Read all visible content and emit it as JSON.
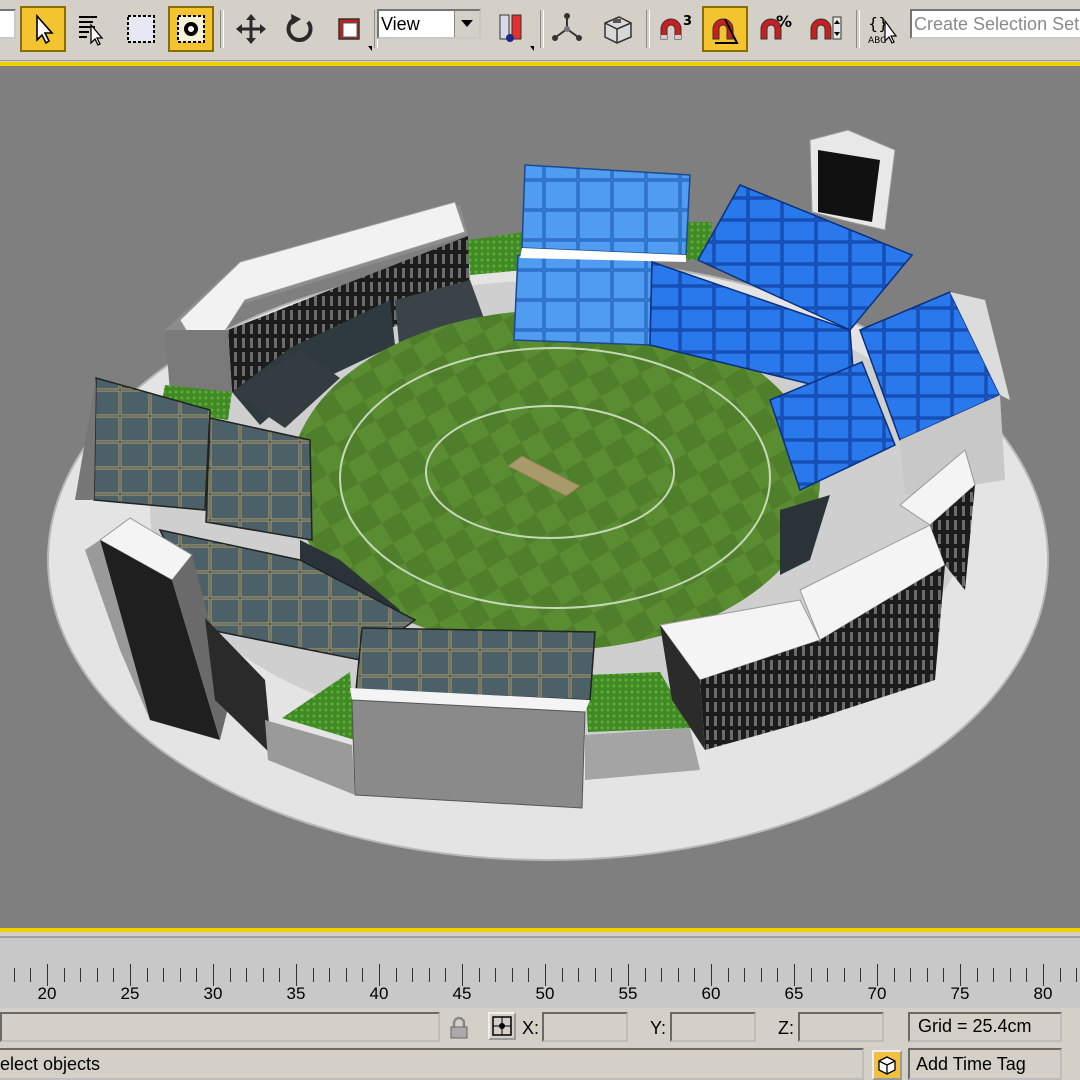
{
  "toolbar": {
    "ref_coord_value": "View",
    "selection_set_placeholder": "Create Selection Set",
    "snap_angle_label": "3",
    "snap_percent_label": "%",
    "accent_color": "#f4c430"
  },
  "viewport": {
    "frame_color": "#f0d000",
    "background": "#7f7f7f"
  },
  "timeline": {
    "ticks": [
      "20",
      "25",
      "30",
      "35",
      "40",
      "45",
      "50",
      "55",
      "60",
      "65",
      "70",
      "75",
      "80"
    ]
  },
  "status": {
    "lock_icon": "lock-icon",
    "abs_toggle_icon": "abs-mode-icon",
    "x_label": "X:",
    "y_label": "Y:",
    "z_label": "Z:",
    "x_value": "",
    "y_value": "",
    "z_value": "",
    "grid_text": "Grid = 25.4cm",
    "prompt_text": "elect objects",
    "add_time_tag": "Add Time Tag"
  }
}
